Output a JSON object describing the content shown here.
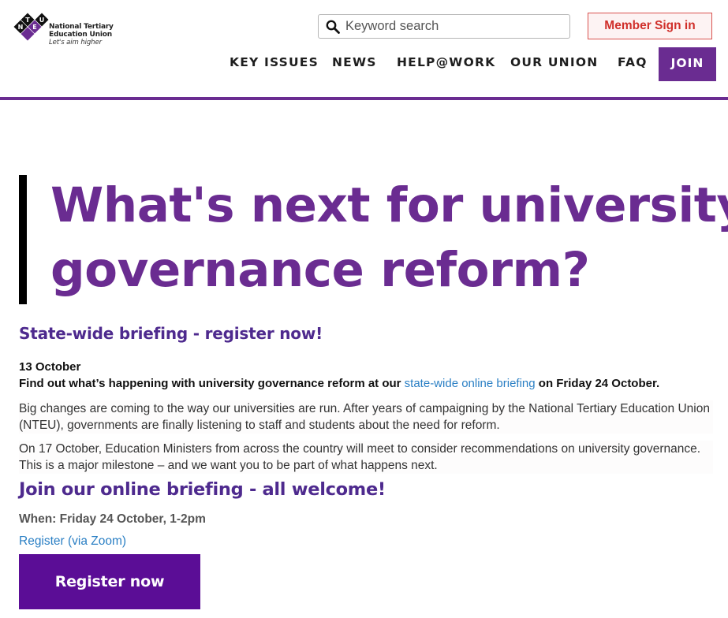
{
  "header": {
    "logo": {
      "letters": [
        "N",
        "T",
        "E",
        "U"
      ],
      "line1": "National Tertiary",
      "line2": "Education Union",
      "tagline": "Let's aim higher"
    },
    "search": {
      "placeholder": "Keyword search",
      "icon": "search-icon"
    },
    "signin_label": "Member Sign in",
    "nav": {
      "key_issues": "KEY ISSUES",
      "news": "NEWS",
      "help": "HELP@WORK",
      "our_union": "OUR UNION",
      "faq": "FAQ",
      "join": "JOIN"
    }
  },
  "colors": {
    "brand_purple": "#6a2c91",
    "heading_purple": "#4e2a8e",
    "button_purple": "#5b0d96",
    "link_blue": "#2a7fc4",
    "signin_red": "#d0302b"
  },
  "article": {
    "title_line1": "What's next for university",
    "title_line2": "governance reform?",
    "subheading": "State-wide briefing - register now!",
    "date": "13 October",
    "lede_before": "Find out what’s happening with university governance reform at our ",
    "lede_link": "state-wide online briefing",
    "lede_after": " on Friday 24 October.",
    "para1": "Big changes are coming to the way our universities are run. After years of campaigning by the National Tertiary Education Union (NTEU), governments are finally listening to staff and students about the need for reform.",
    "para2": "On 17 October, Education Ministers from across the country will meet to consider recommendations on university governance. This is a major milestone – and we want you to be part of what happens next.",
    "join_heading": "Join our online briefing - all welcome!",
    "when": "When: Friday 24 October, 1-2pm",
    "register_link": "Register (via Zoom)",
    "register_button": "Register now"
  }
}
